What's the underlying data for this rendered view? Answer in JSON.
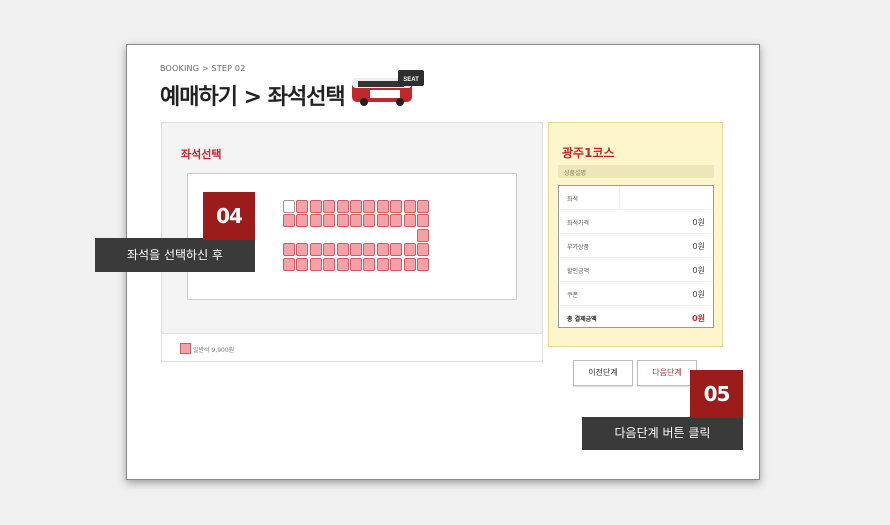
{
  "breadcrumb": "BOOKING > STEP 02",
  "title": "예매하기 > 좌석선택",
  "bus_badge": "SEAT",
  "seat_panel": {
    "title": "좌석선택",
    "legend": "일반석 9,900원"
  },
  "info": {
    "course": "광주1코스",
    "desc": "상품설명",
    "rows": [
      {
        "label": "좌석",
        "value": ""
      },
      {
        "label": "좌석가격",
        "value": "0원"
      },
      {
        "label": "부가상품",
        "value": "0원"
      },
      {
        "label": "할인금액",
        "value": "0원"
      },
      {
        "label": "쿠폰",
        "value": "0원"
      },
      {
        "label": "총 결제금액",
        "value": "0원"
      }
    ]
  },
  "buttons": {
    "prev": "이전단계",
    "next": "다음단계"
  },
  "annotations": {
    "step04_number": "04",
    "step04_text": "좌석을 선택하신 후",
    "step05_number": "05",
    "step05_text": "다음단계 버튼 클릭"
  },
  "colors": {
    "accent": "#c0272d",
    "seat": "#f3a2a8",
    "badge": "#9c1c1b",
    "callout": "#3a3a3a"
  }
}
